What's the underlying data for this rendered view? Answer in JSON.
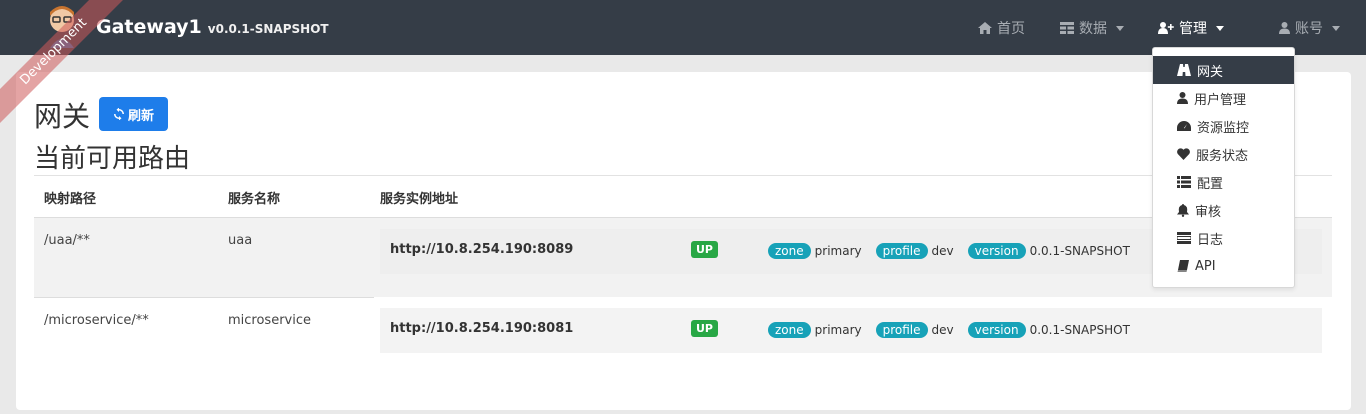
{
  "brand": {
    "name": "Gateway1",
    "version": "v0.0.1-SNAPSHOT",
    "ribbon": "Development"
  },
  "nav": {
    "home": "首页",
    "data": "数据",
    "admin": "管理",
    "account": "账号"
  },
  "admin_menu": [
    {
      "label": "网关",
      "icon": "road-icon",
      "active": true
    },
    {
      "label": "用户管理",
      "icon": "user-icon",
      "active": false
    },
    {
      "label": "资源监控",
      "icon": "tachometer-icon",
      "active": false
    },
    {
      "label": "服务状态",
      "icon": "heart-icon",
      "active": false
    },
    {
      "label": "配置",
      "icon": "list-icon",
      "active": false
    },
    {
      "label": "审核",
      "icon": "bell-icon",
      "active": false
    },
    {
      "label": "日志",
      "icon": "tasks-icon",
      "active": false
    },
    {
      "label": "API",
      "icon": "book-icon",
      "active": false
    }
  ],
  "page": {
    "title": "网关",
    "refresh_label": "刷新",
    "subtitle": "当前可用路由"
  },
  "table": {
    "headers": [
      "映射路径",
      "服务名称",
      "服务实例地址"
    ],
    "rows": [
      {
        "path": "/uaa/**",
        "service": "uaa",
        "instance": {
          "url": "http://10.8.254.190:8089",
          "status": "UP",
          "zone_label": "zone",
          "zone": "primary",
          "profile_label": "profile",
          "profile": "dev",
          "version_label": "version",
          "version": "0.0.1-SNAPSHOT"
        }
      },
      {
        "path": "/microservice/**",
        "service": "microservice",
        "instance": {
          "url": "http://10.8.254.190:8081",
          "status": "UP",
          "zone_label": "zone",
          "zone": "primary",
          "profile_label": "profile",
          "profile": "dev",
          "version_label": "version",
          "version": "0.0.1-SNAPSHOT"
        }
      }
    ]
  },
  "colors": {
    "navbar": "#353d47",
    "primary": "#1e7dea",
    "success": "#28a745",
    "info": "#17a2b8"
  }
}
